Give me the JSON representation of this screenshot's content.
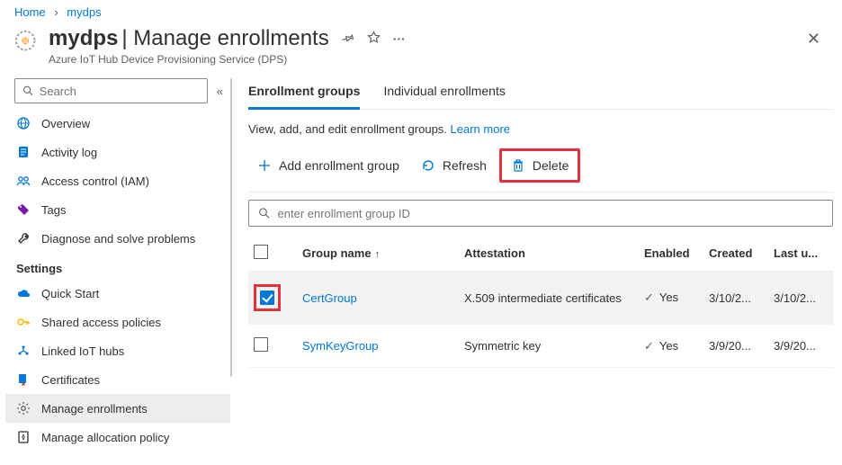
{
  "breadcrumb": {
    "home": "Home",
    "current": "mydps"
  },
  "header": {
    "name": "mydps",
    "section": "Manage enrollments",
    "subtitle": "Azure IoT Hub Device Provisioning Service (DPS)"
  },
  "search": {
    "placeholder": "Search"
  },
  "sidebar": {
    "items": [
      {
        "label": "Overview",
        "icon": "globe",
        "color": "#0078d4"
      },
      {
        "label": "Activity log",
        "icon": "log",
        "color": "#0078d4"
      },
      {
        "label": "Access control (IAM)",
        "icon": "people",
        "color": "#0078d4"
      },
      {
        "label": "Tags",
        "icon": "tag",
        "color": "#7719aa"
      },
      {
        "label": "Diagnose and solve problems",
        "icon": "wrench",
        "color": "#323130"
      }
    ],
    "settings_label": "Settings",
    "settings": [
      {
        "label": "Quick Start",
        "icon": "cloud",
        "color": "#0078d4"
      },
      {
        "label": "Shared access policies",
        "icon": "key",
        "color": "#ffb900"
      },
      {
        "label": "Linked IoT hubs",
        "icon": "hub",
        "color": "#0078d4"
      },
      {
        "label": "Certificates",
        "icon": "cert",
        "color": "#0078d4"
      },
      {
        "label": "Manage enrollments",
        "icon": "gear",
        "color": "#605e5c",
        "selected": true
      },
      {
        "label": "Manage allocation policy",
        "icon": "policy",
        "color": "#323130"
      }
    ]
  },
  "tabs": {
    "groups": "Enrollment groups",
    "individual": "Individual enrollments"
  },
  "content": {
    "desc": "View, add, and edit enrollment groups.",
    "learn": "Learn more",
    "add": "Add enrollment group",
    "refresh": "Refresh",
    "delete": "Delete",
    "filter_placeholder": "enter enrollment group ID"
  },
  "table": {
    "headers": {
      "name": "Group name",
      "attestation": "Attestation",
      "enabled": "Enabled",
      "created": "Created",
      "last": "Last u..."
    },
    "rows": [
      {
        "selected": true,
        "name": "CertGroup",
        "attestation": "X.509 intermediate certificates",
        "enabled": "Yes",
        "created": "3/10/2...",
        "last": "3/10/2..."
      },
      {
        "selected": false,
        "name": "SymKeyGroup",
        "attestation": "Symmetric key",
        "enabled": "Yes",
        "created": "3/9/20...",
        "last": "3/9/20..."
      }
    ]
  }
}
